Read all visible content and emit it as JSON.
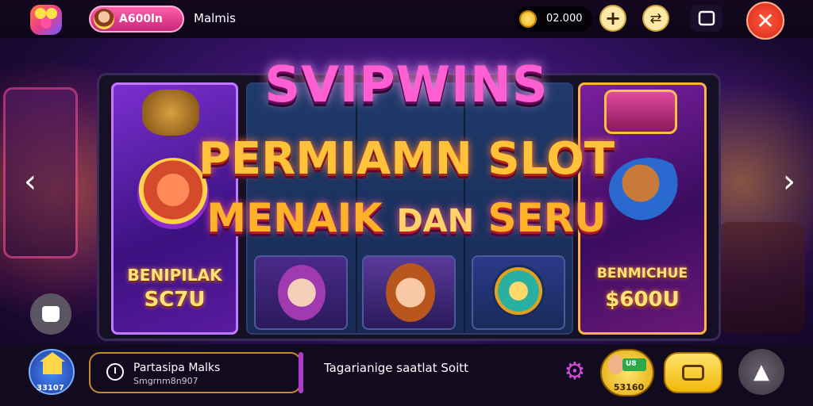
{
  "topbar": {
    "profile_name": "A600ln",
    "title": "Malmis",
    "coins": "02.000",
    "plus_label": "+",
    "swap_label": "⇄",
    "close_label": "✕"
  },
  "game": {
    "brand": "SVIPWINS",
    "headline_line1": "PERMIAMN SLOT",
    "headline_line2_a": "MENAIK",
    "headline_line2_b": "DAN",
    "headline_line2_c": "SERU",
    "left_bonus_line1": "BENIPILAK",
    "left_bonus_line2": "SC7U",
    "right_bonus_line1": "BENMICHUE",
    "right_bonus_line2": "$600U"
  },
  "nav": {
    "prev_label": "‹",
    "next_label": "›"
  },
  "bottombar": {
    "home_count": "33107",
    "mission_title": "Partasipa Malks",
    "mission_subtitle": "Smgrnm8n907",
    "ticker_text": "Tagarianige saatlat Soitt",
    "cash_label": "53160",
    "cash_badge": "U8"
  },
  "colors": {
    "accent_pink": "#ff5fd2",
    "headline_gold": "#ffc23a",
    "close_red": "#d8261b"
  }
}
